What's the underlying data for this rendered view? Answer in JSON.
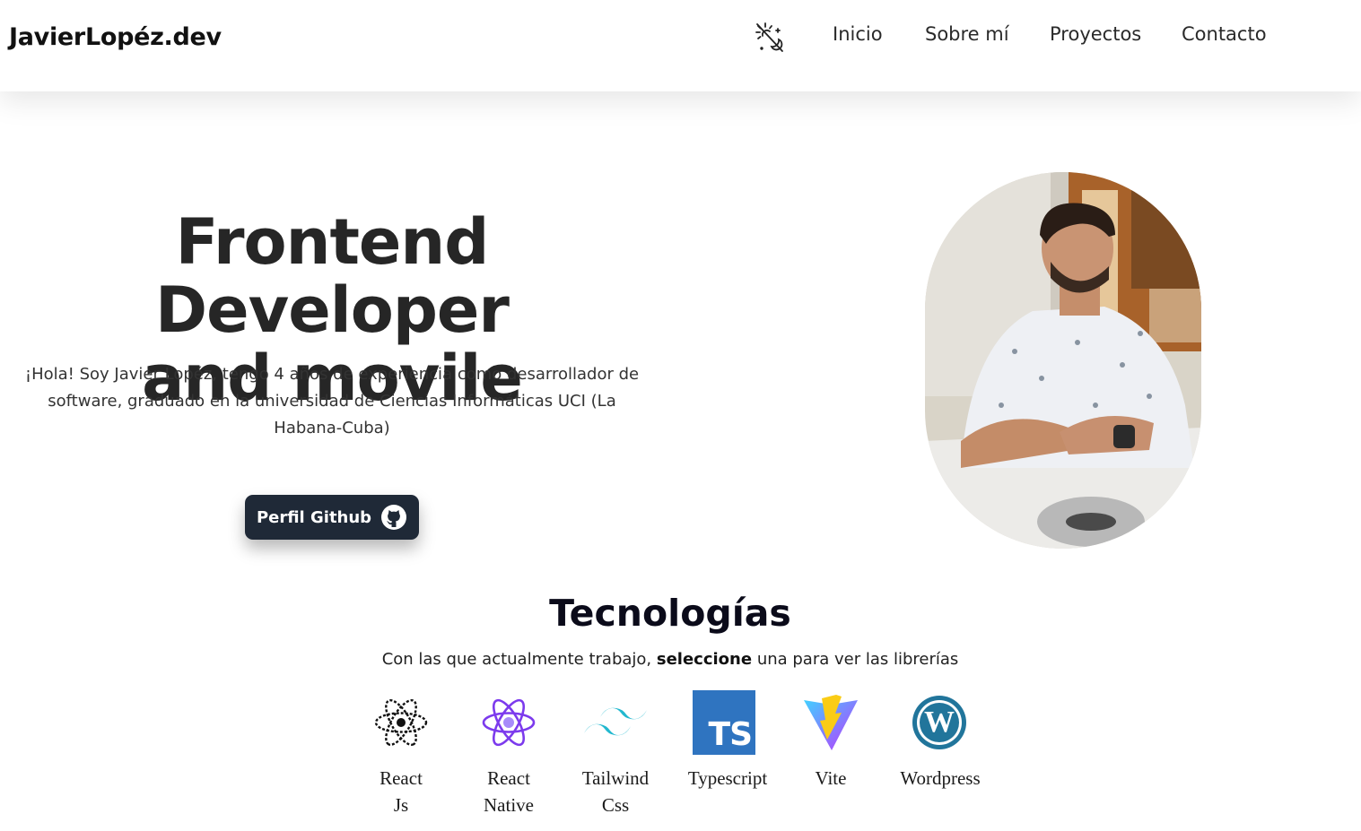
{
  "header": {
    "brand": "JavierLopéz.dev",
    "theme_toggle_icon": "sun-moon-icon",
    "nav": [
      "Inicio",
      "Sobre mí",
      "Proyectos",
      "Contacto"
    ]
  },
  "hero": {
    "title_line1": "Frontend Developer",
    "title_line2": "and movile",
    "description": "¡Hola! Soy Javier Lopéz, tengo 4 años de experiencia como desarrollador de software, graduado en la universidad de Ciencias Informáticas UCI (La Habana-Cuba)",
    "cta_label": "Perfil Github",
    "cta_icon": "github-icon"
  },
  "tech": {
    "title": "Tecnologías",
    "subtitle_before": "Con las que actualmente trabajo,",
    "subtitle_bold": "seleccione",
    "subtitle_after": "una para ver las librerías",
    "items": [
      {
        "line1": "React",
        "line2": "Js",
        "icon": "react-icon"
      },
      {
        "line1": "React",
        "line2": "Native",
        "icon": "react-native-icon"
      },
      {
        "line1": "Tailwind",
        "line2": "Css",
        "icon": "tailwind-icon"
      },
      {
        "line1": "Typescript",
        "line2": "",
        "icon": "typescript-icon",
        "badge": "TS"
      },
      {
        "line1": "Vite",
        "line2": "",
        "icon": "vite-icon"
      },
      {
        "line1": "Wordpress",
        "line2": "",
        "icon": "wordpress-icon",
        "badge": "W"
      }
    ]
  },
  "colors": {
    "button_bg": "#1f2937",
    "react_native": "#7c3aed",
    "tailwind": "#22b8cf",
    "typescript": "#2f74c0",
    "vite_purple": "#8b5cf6",
    "vite_yellow": "#facc15",
    "wordpress": "#21759b"
  }
}
